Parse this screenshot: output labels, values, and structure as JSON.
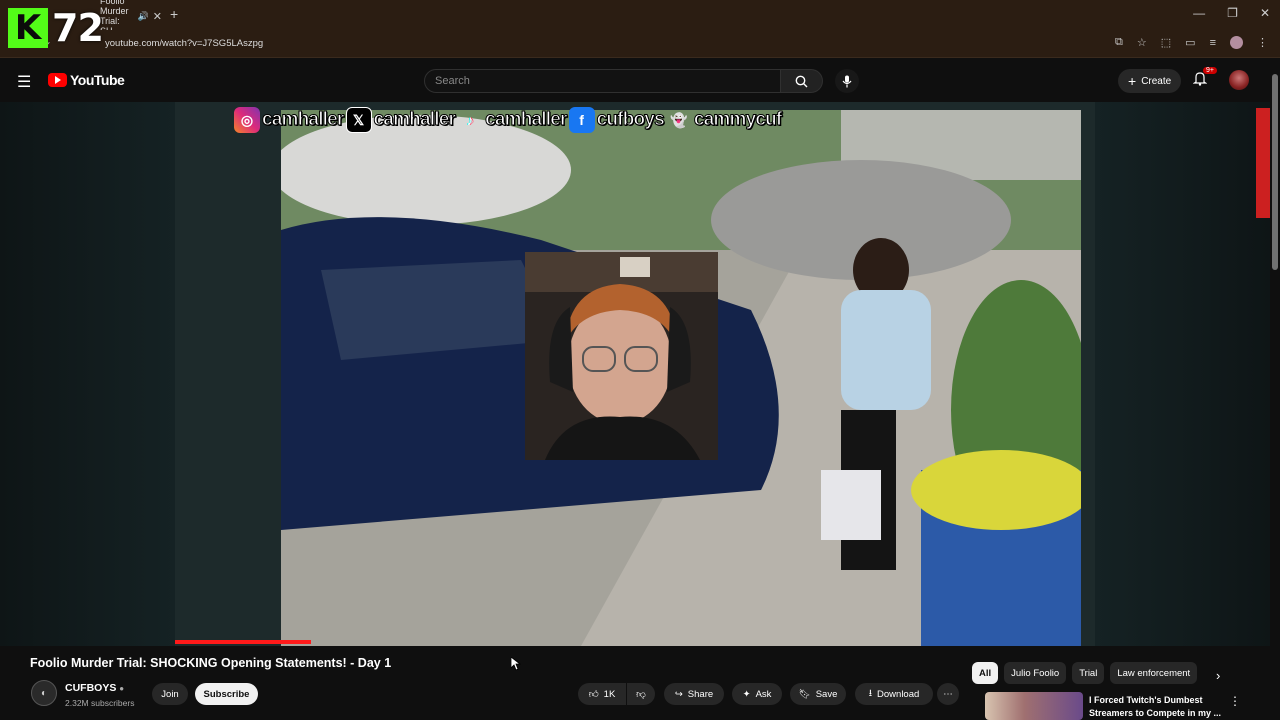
{
  "browser": {
    "tab_title": "Foolio Murder Trial: SH",
    "url": "youtube.com/watch?v=J7SG5LAszpg"
  },
  "stream_overlay": {
    "logo_letter": "K",
    "viewer_count": "72"
  },
  "header": {
    "brand": "YouTube",
    "search_placeholder": "Search",
    "create_label": "Create",
    "notifications_badge": "9+"
  },
  "video_overlay": {
    "socials": [
      {
        "platform": "instagram",
        "handle": "camhaller",
        "color": "#c13584"
      },
      {
        "platform": "x",
        "handle": "camhaller",
        "color": "#000000"
      },
      {
        "platform": "tiktok",
        "handle": "camhaller",
        "color": "#000000"
      },
      {
        "platform": "facebook",
        "handle": "cufboys",
        "color": "#1877f2"
      },
      {
        "platform": "snapchat",
        "handle": "cammycuf",
        "color": "#fffc00"
      }
    ],
    "progress_fraction": 0.148
  },
  "video": {
    "title": "Foolio Murder Trial: SHOCKING Opening Statements! - Day 1",
    "channel": "CUFBOYS",
    "subscribers": "2.32M subscribers",
    "join_label": "Join",
    "subscribe_label": "Subscribe",
    "likes": "1K",
    "share_label": "Share",
    "ask_label": "Ask",
    "save_label": "Save",
    "download_label": "Download"
  },
  "chips": [
    "All",
    "Julio Foolio",
    "Trial",
    "Law enforcement"
  ],
  "recommendation": {
    "title": "I Forced Twitch's Dumbest Streamers to Compete in my ..."
  },
  "colors": {
    "yt_red": "#ff0000",
    "kick_green": "#53fc18",
    "background": "#0f0f0f"
  }
}
